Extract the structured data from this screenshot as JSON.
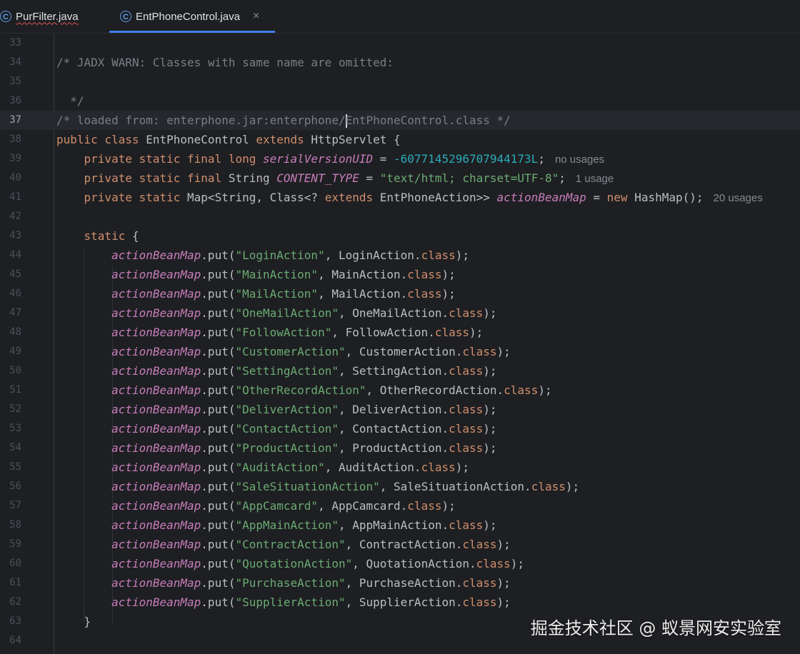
{
  "tabs": [
    {
      "label": "PurFilter.java",
      "icon": "class-icon",
      "active": false
    },
    {
      "label": "EntPhoneControl.java",
      "icon": "class-icon",
      "active": true
    }
  ],
  "tab_close_glyph": "×",
  "colors": {
    "background": "#1e1f22",
    "keyword": "#cf8e6d",
    "comment": "#7a7e85",
    "string": "#6aab73",
    "number": "#2aacb8",
    "field": "#c77dbb",
    "active_tab_accent": "#3d7dea"
  },
  "editor": {
    "current_line": 37,
    "lines": [
      {
        "n": "33",
        "segs": []
      },
      {
        "n": "34",
        "segs": [
          {
            "t": "/* JADX WARN: Classes with same name are omitted:",
            "c": "cm"
          }
        ]
      },
      {
        "n": "35",
        "segs": []
      },
      {
        "n": "36",
        "segs": [
          {
            "t": "  */",
            "c": "cm"
          }
        ]
      },
      {
        "n": "37",
        "current": true,
        "segs": [
          {
            "t": "/* loaded from: enterphone.jar:enterphone/",
            "c": "cm"
          },
          {
            "caret": true
          },
          {
            "t": "EntPhoneControl.class */",
            "c": "cm"
          }
        ]
      },
      {
        "n": "38",
        "segs": [
          {
            "t": "public class ",
            "c": "kw"
          },
          {
            "t": "EntPhoneControl "
          },
          {
            "t": "extends ",
            "c": "kw"
          },
          {
            "t": "HttpServlet {"
          }
        ]
      },
      {
        "n": "39",
        "segs": [
          {
            "t": "    "
          },
          {
            "t": "private static final long ",
            "c": "kw"
          },
          {
            "t": "serialVersionUID",
            "c": "fld"
          },
          {
            "t": " = "
          },
          {
            "t": "-6077145296707944173L",
            "c": "num"
          },
          {
            "t": ";"
          },
          {
            "t": "no usages",
            "c": "hint"
          }
        ]
      },
      {
        "n": "40",
        "segs": [
          {
            "t": "    "
          },
          {
            "t": "private static final ",
            "c": "kw"
          },
          {
            "t": "String "
          },
          {
            "t": "CONTENT_TYPE",
            "c": "fld"
          },
          {
            "t": " = "
          },
          {
            "t": "\"text/html; charset=UTF-8\"",
            "c": "str"
          },
          {
            "t": ";"
          },
          {
            "t": "1 usage",
            "c": "hint"
          }
        ]
      },
      {
        "n": "41",
        "segs": [
          {
            "t": "    "
          },
          {
            "t": "private static ",
            "c": "kw"
          },
          {
            "t": "Map<String, Class<? "
          },
          {
            "t": "extends ",
            "c": "kw"
          },
          {
            "t": "EntPhoneAction>> "
          },
          {
            "t": "actionBeanMap",
            "c": "fld"
          },
          {
            "t": " = "
          },
          {
            "t": "new ",
            "c": "kw"
          },
          {
            "t": "HashMap();"
          },
          {
            "t": "20 usages",
            "c": "hint"
          }
        ]
      },
      {
        "n": "42",
        "segs": []
      },
      {
        "n": "43",
        "segs": [
          {
            "t": "    "
          },
          {
            "t": "static ",
            "c": "kw"
          },
          {
            "t": "{"
          }
        ]
      },
      {
        "n": "44",
        "segs": [
          {
            "t": "        "
          },
          {
            "t": "actionBeanMap",
            "c": "fld"
          },
          {
            "t": ".put("
          },
          {
            "t": "\"LoginAction\"",
            "c": "str"
          },
          {
            "t": ", LoginAction."
          },
          {
            "t": "class",
            "c": "kw"
          },
          {
            "t": ");"
          }
        ]
      },
      {
        "n": "45",
        "segs": [
          {
            "t": "        "
          },
          {
            "t": "actionBeanMap",
            "c": "fld"
          },
          {
            "t": ".put("
          },
          {
            "t": "\"MainAction\"",
            "c": "str"
          },
          {
            "t": ", MainAction."
          },
          {
            "t": "class",
            "c": "kw"
          },
          {
            "t": ");"
          }
        ]
      },
      {
        "n": "46",
        "segs": [
          {
            "t": "        "
          },
          {
            "t": "actionBeanMap",
            "c": "fld"
          },
          {
            "t": ".put("
          },
          {
            "t": "\"MailAction\"",
            "c": "str"
          },
          {
            "t": ", MailAction."
          },
          {
            "t": "class",
            "c": "kw"
          },
          {
            "t": ");"
          }
        ]
      },
      {
        "n": "47",
        "segs": [
          {
            "t": "        "
          },
          {
            "t": "actionBeanMap",
            "c": "fld"
          },
          {
            "t": ".put("
          },
          {
            "t": "\"OneMailAction\"",
            "c": "str"
          },
          {
            "t": ", OneMailAction."
          },
          {
            "t": "class",
            "c": "kw"
          },
          {
            "t": ");"
          }
        ]
      },
      {
        "n": "48",
        "segs": [
          {
            "t": "        "
          },
          {
            "t": "actionBeanMap",
            "c": "fld"
          },
          {
            "t": ".put("
          },
          {
            "t": "\"FollowAction\"",
            "c": "str"
          },
          {
            "t": ", FollowAction."
          },
          {
            "t": "class",
            "c": "kw"
          },
          {
            "t": ");"
          }
        ]
      },
      {
        "n": "49",
        "segs": [
          {
            "t": "        "
          },
          {
            "t": "actionBeanMap",
            "c": "fld"
          },
          {
            "t": ".put("
          },
          {
            "t": "\"CustomerAction\"",
            "c": "str"
          },
          {
            "t": ", CustomerAction."
          },
          {
            "t": "class",
            "c": "kw"
          },
          {
            "t": ");"
          }
        ]
      },
      {
        "n": "50",
        "segs": [
          {
            "t": "        "
          },
          {
            "t": "actionBeanMap",
            "c": "fld"
          },
          {
            "t": ".put("
          },
          {
            "t": "\"SettingAction\"",
            "c": "str"
          },
          {
            "t": ", SettingAction."
          },
          {
            "t": "class",
            "c": "kw"
          },
          {
            "t": ");"
          }
        ]
      },
      {
        "n": "51",
        "segs": [
          {
            "t": "        "
          },
          {
            "t": "actionBeanMap",
            "c": "fld"
          },
          {
            "t": ".put("
          },
          {
            "t": "\"OtherRecordAction\"",
            "c": "str"
          },
          {
            "t": ", OtherRecordAction."
          },
          {
            "t": "class",
            "c": "kw"
          },
          {
            "t": ");"
          }
        ]
      },
      {
        "n": "52",
        "segs": [
          {
            "t": "        "
          },
          {
            "t": "actionBeanMap",
            "c": "fld"
          },
          {
            "t": ".put("
          },
          {
            "t": "\"DeliverAction\"",
            "c": "str"
          },
          {
            "t": ", DeliverAction."
          },
          {
            "t": "class",
            "c": "kw"
          },
          {
            "t": ");"
          }
        ]
      },
      {
        "n": "53",
        "segs": [
          {
            "t": "        "
          },
          {
            "t": "actionBeanMap",
            "c": "fld"
          },
          {
            "t": ".put("
          },
          {
            "t": "\"ContactAction\"",
            "c": "str"
          },
          {
            "t": ", ContactAction."
          },
          {
            "t": "class",
            "c": "kw"
          },
          {
            "t": ");"
          }
        ]
      },
      {
        "n": "54",
        "segs": [
          {
            "t": "        "
          },
          {
            "t": "actionBeanMap",
            "c": "fld"
          },
          {
            "t": ".put("
          },
          {
            "t": "\"ProductAction\"",
            "c": "str"
          },
          {
            "t": ", ProductAction."
          },
          {
            "t": "class",
            "c": "kw"
          },
          {
            "t": ");"
          }
        ]
      },
      {
        "n": "55",
        "segs": [
          {
            "t": "        "
          },
          {
            "t": "actionBeanMap",
            "c": "fld"
          },
          {
            "t": ".put("
          },
          {
            "t": "\"AuditAction\"",
            "c": "str"
          },
          {
            "t": ", AuditAction."
          },
          {
            "t": "class",
            "c": "kw"
          },
          {
            "t": ");"
          }
        ]
      },
      {
        "n": "56",
        "segs": [
          {
            "t": "        "
          },
          {
            "t": "actionBeanMap",
            "c": "fld"
          },
          {
            "t": ".put("
          },
          {
            "t": "\"SaleSituationAction\"",
            "c": "str"
          },
          {
            "t": ", SaleSituationAction."
          },
          {
            "t": "class",
            "c": "kw"
          },
          {
            "t": ");"
          }
        ]
      },
      {
        "n": "57",
        "segs": [
          {
            "t": "        "
          },
          {
            "t": "actionBeanMap",
            "c": "fld"
          },
          {
            "t": ".put("
          },
          {
            "t": "\"AppCamcard\"",
            "c": "str"
          },
          {
            "t": ", AppCamcard."
          },
          {
            "t": "class",
            "c": "kw"
          },
          {
            "t": ");"
          }
        ]
      },
      {
        "n": "58",
        "segs": [
          {
            "t": "        "
          },
          {
            "t": "actionBeanMap",
            "c": "fld"
          },
          {
            "t": ".put("
          },
          {
            "t": "\"AppMainAction\"",
            "c": "str"
          },
          {
            "t": ", AppMainAction."
          },
          {
            "t": "class",
            "c": "kw"
          },
          {
            "t": ");"
          }
        ]
      },
      {
        "n": "59",
        "segs": [
          {
            "t": "        "
          },
          {
            "t": "actionBeanMap",
            "c": "fld"
          },
          {
            "t": ".put("
          },
          {
            "t": "\"ContractAction\"",
            "c": "str"
          },
          {
            "t": ", ContractAction."
          },
          {
            "t": "class",
            "c": "kw"
          },
          {
            "t": ");"
          }
        ]
      },
      {
        "n": "60",
        "segs": [
          {
            "t": "        "
          },
          {
            "t": "actionBeanMap",
            "c": "fld"
          },
          {
            "t": ".put("
          },
          {
            "t": "\"QuotationAction\"",
            "c": "str"
          },
          {
            "t": ", QuotationAction."
          },
          {
            "t": "class",
            "c": "kw"
          },
          {
            "t": ");"
          }
        ]
      },
      {
        "n": "61",
        "segs": [
          {
            "t": "        "
          },
          {
            "t": "actionBeanMap",
            "c": "fld"
          },
          {
            "t": ".put("
          },
          {
            "t": "\"PurchaseAction\"",
            "c": "str"
          },
          {
            "t": ", PurchaseAction."
          },
          {
            "t": "class",
            "c": "kw"
          },
          {
            "t": ");"
          }
        ]
      },
      {
        "n": "62",
        "segs": [
          {
            "t": "        "
          },
          {
            "t": "actionBeanMap",
            "c": "fld"
          },
          {
            "t": ".put("
          },
          {
            "t": "\"SupplierAction\"",
            "c": "str"
          },
          {
            "t": ", SupplierAction."
          },
          {
            "t": "class",
            "c": "kw"
          },
          {
            "t": ");"
          }
        ]
      },
      {
        "n": "63",
        "segs": [
          {
            "t": "    }"
          }
        ]
      },
      {
        "n": "64",
        "segs": []
      }
    ]
  },
  "watermark": "掘金技术社区 @ 蚁景网安实验室"
}
